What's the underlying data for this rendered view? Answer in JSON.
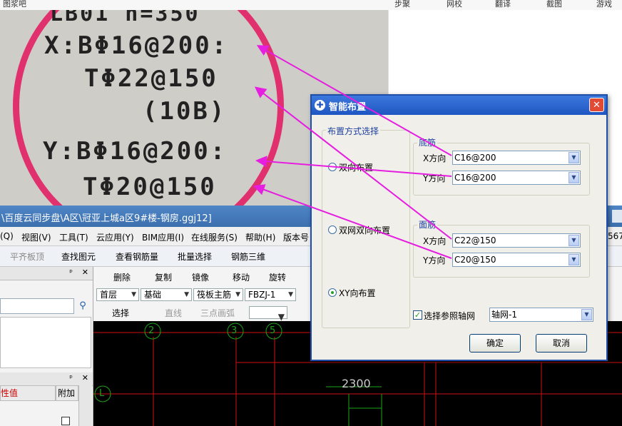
{
  "browser_bar": {
    "left_text": "图浆吧",
    "items": [
      "步聚",
      "网校",
      "翻译",
      "截图",
      "游戏"
    ]
  },
  "photo": {
    "lines": [
      "LB01 h=350",
      "X:BΦ16@200:",
      "TΦ22@150",
      "(10B)",
      "Y:BΦ16@200:",
      "TΦ20@150"
    ]
  },
  "app": {
    "title": "\\百度云同步盘\\A区\\冠亚上城a区9#楼-钢房.ggj12]",
    "menu": [
      "(Q)",
      "视图(V)",
      "工具(T)",
      "云应用(Y)",
      "BIM应用(I)",
      "在线服务(S)",
      "帮助(H)",
      "版本号"
    ],
    "menu_right": "567",
    "toolbar1": [
      "平齐板顶",
      "查找图元",
      "查看钢筋量",
      "批量选择",
      "钢筋三维"
    ],
    "toolbar2": [
      "删除",
      "复制",
      "镜像",
      "移动",
      "旋转"
    ],
    "floor_combos": [
      "首层",
      "基础",
      "筏板主筋",
      "FBZJ-1"
    ],
    "toolbar3": [
      "选择",
      "直线",
      "三点画弧"
    ],
    "panel2_headers": [
      "性值",
      "附加"
    ],
    "axis_labels": [
      "2",
      "3",
      "5",
      "L"
    ],
    "dimension": "2300"
  },
  "dialog": {
    "title": "智能布置",
    "close_label": "✕",
    "layout_group": "布置方式选择",
    "radios": [
      {
        "label": "双向布置",
        "checked": false
      },
      {
        "label": "双网双向布置",
        "checked": false
      },
      {
        "label": "XY向布置",
        "checked": true
      }
    ],
    "bottom_group": {
      "label": "底筋",
      "x_label": "X方向",
      "x_value": "C16@200",
      "y_label": "Y方向",
      "y_value": "C16@200"
    },
    "top_group": {
      "label": "面筋",
      "x_label": "X方向",
      "x_value": "C22@150",
      "y_label": "Y方向",
      "y_value": "C20@150"
    },
    "ref_axis_label": "选择参照轴网",
    "ref_axis_checked": true,
    "ref_axis_value": "轴网-1",
    "ok_label": "确定",
    "cancel_label": "取消"
  },
  "colors": {
    "annotation_arrow": "#e51ee0",
    "photo_circle": "#e0306e",
    "dialog_title": "#1f56c2",
    "cad_line": "#d01010",
    "cad_axis": "#1aa51a"
  },
  "icons": [
    "search-icon",
    "close-icon",
    "chevron-down-icon",
    "checkbox-icon",
    "radio-icon",
    "dialog-app-icon"
  ]
}
